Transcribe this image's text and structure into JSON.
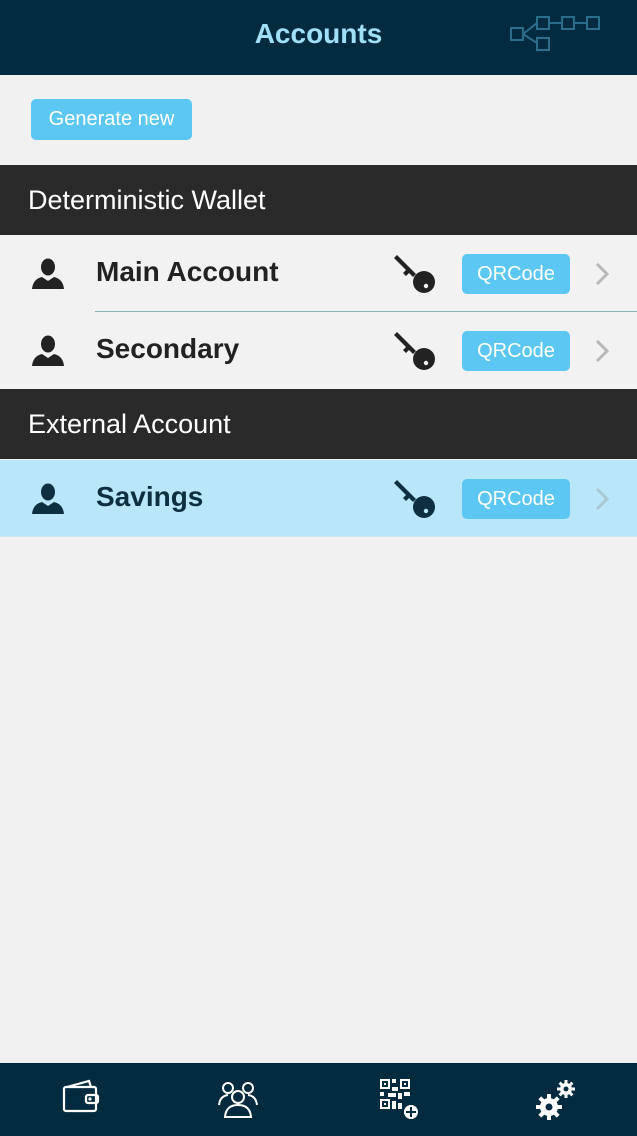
{
  "header": {
    "title": "Accounts",
    "chain_icon": "blockchain-icon"
  },
  "toolbar": {
    "generate_label": "Generate new"
  },
  "sections": [
    {
      "title": "Deterministic Wallet",
      "accounts": [
        {
          "name": "Main Account",
          "qr_label": "QRCode",
          "selected": false
        },
        {
          "name": "Secondary",
          "qr_label": "QRCode",
          "selected": false
        }
      ]
    },
    {
      "title": "External Account",
      "accounts": [
        {
          "name": "Savings",
          "qr_label": "QRCode",
          "selected": true
        }
      ]
    }
  ],
  "tabbar": {
    "tabs": [
      {
        "icon": "wallet-icon"
      },
      {
        "icon": "contacts-icon"
      },
      {
        "icon": "qr-scan-icon"
      },
      {
        "icon": "settings-gears-icon"
      }
    ]
  },
  "colors": {
    "header_bg": "#032b40",
    "header_title": "#9fe0f8",
    "accent": "#5bc7f2",
    "section_bg": "#2a2a2a",
    "selected_row": "#b9e6f8",
    "page_bg": "#f1f1f1"
  }
}
